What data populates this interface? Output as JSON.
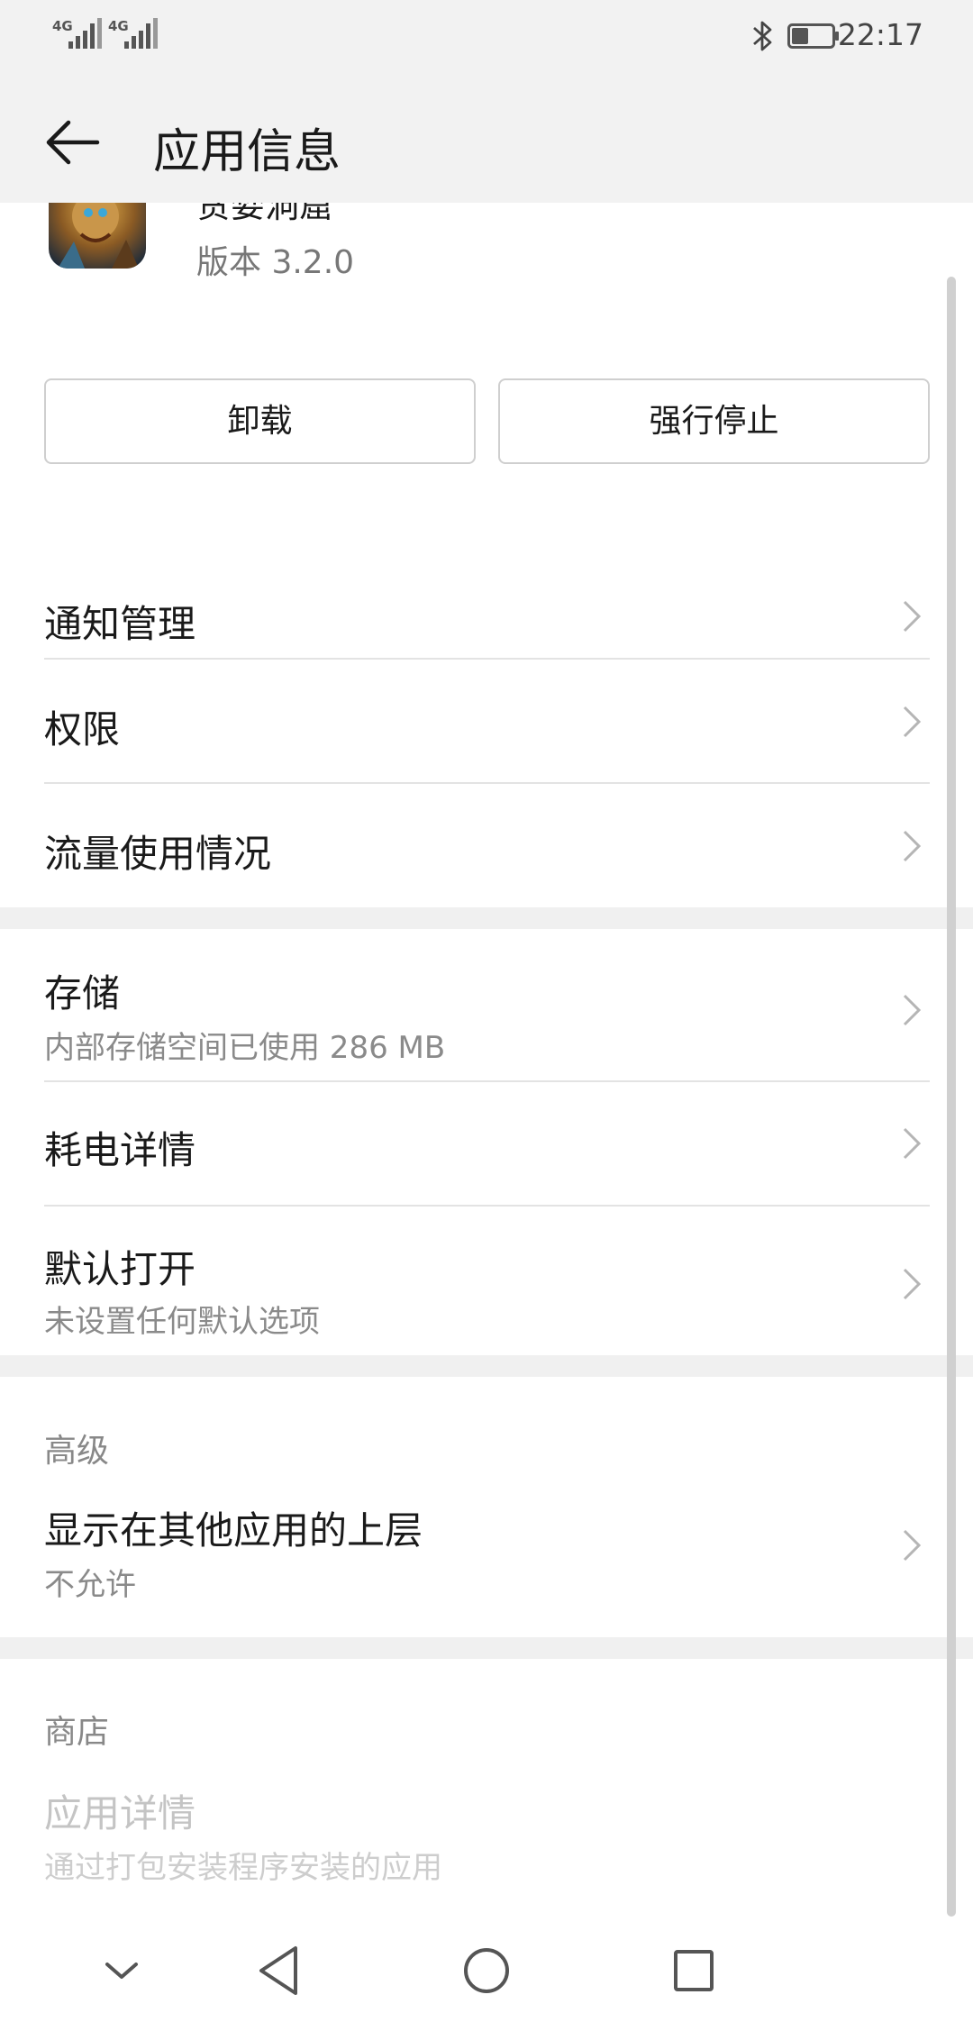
{
  "status_bar": {
    "network1": "4G",
    "network2": "4G",
    "time": "22:17",
    "icons": [
      "signal-icon",
      "signal-icon",
      "bluetooth-icon",
      "battery-icon"
    ]
  },
  "app_bar": {
    "title": "应用信息",
    "back_icon": "arrow-left-icon"
  },
  "app": {
    "name": "贪婪洞窟",
    "version": "版本 3.2.0"
  },
  "actions": {
    "uninstall": "卸载",
    "force_stop": "强行停止"
  },
  "section1": [
    {
      "title": "通知管理"
    },
    {
      "title": "权限"
    },
    {
      "title": "流量使用情况"
    }
  ],
  "section2": [
    {
      "title": "存储",
      "subtitle": "内部存储空间已使用 286 MB"
    },
    {
      "title": "耗电详情"
    },
    {
      "title": "默认打开",
      "subtitle": "未设置任何默认选项"
    }
  ],
  "advanced": {
    "header": "高级",
    "item": {
      "title": "显示在其他应用的上层",
      "subtitle": "不允许"
    }
  },
  "store": {
    "header": "商店",
    "item": {
      "title": "应用详情",
      "subtitle": "通过打包安装程序安装的应用"
    }
  },
  "nav_bar": {
    "icons": [
      "chevron-down-icon",
      "back-triangle-icon",
      "home-circle-icon",
      "recents-square-icon"
    ]
  },
  "colors": {
    "bar_bg": "#f2f2f2",
    "divider": "#e3e3e3",
    "secondary_text": "#8a8a8a",
    "disabled_text": "#c4c4c4"
  }
}
